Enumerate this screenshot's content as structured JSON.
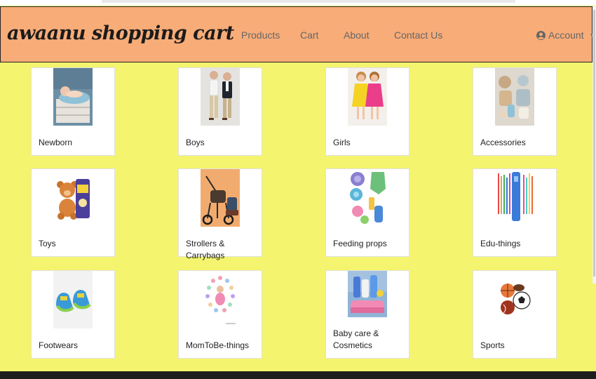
{
  "brand": "awaanu shopping cart",
  "nav": [
    "Products",
    "Cart",
    "About",
    "Contact Us"
  ],
  "account": {
    "label": "Account",
    "icon": "user-circle-icon"
  },
  "categories": [
    {
      "label": "Newborn"
    },
    {
      "label": "Boys"
    },
    {
      "label": "Girls"
    },
    {
      "label": "Accessories"
    },
    {
      "label": "Toys"
    },
    {
      "label": "Strollers & Carrybags"
    },
    {
      "label": "Feeding props"
    },
    {
      "label": "Edu-things"
    },
    {
      "label": "Footwears"
    },
    {
      "label": "MomToBe-things"
    },
    {
      "label": "Baby care &",
      "label2": "Cosmetics"
    },
    {
      "label": "Sports"
    }
  ],
  "colors": {
    "background": "#f4f46e",
    "navbar": "#f8ac78",
    "footer": "#1d1d1d"
  }
}
